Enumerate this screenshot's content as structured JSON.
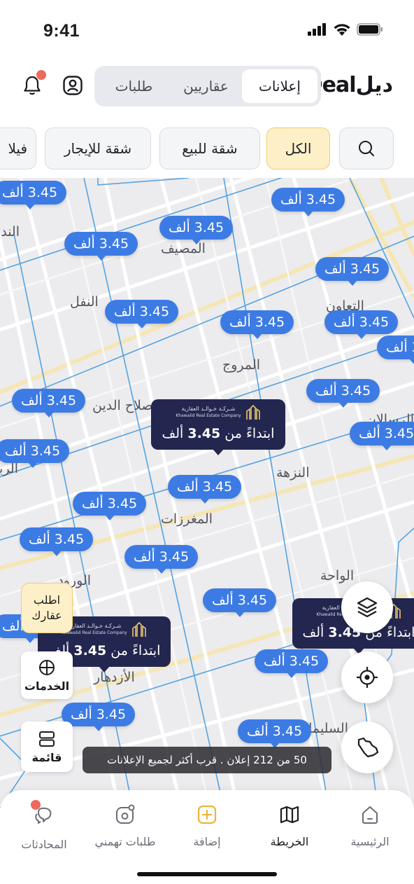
{
  "status_bar": {
    "time": "9:41"
  },
  "header": {
    "logo": "Dealديل",
    "tabs": [
      {
        "label": "إعلانات",
        "active": true
      },
      {
        "label": "عقاريين",
        "active": false
      },
      {
        "label": "طلبات",
        "active": false
      }
    ],
    "icons": [
      "profile-icon",
      "bell-icon"
    ]
  },
  "filters": {
    "search_icon": "search-icon",
    "chips": [
      {
        "label": "الكل",
        "active": true
      },
      {
        "label": "شقة للبيع",
        "active": false
      },
      {
        "label": "شقة للإيجار",
        "active": false
      },
      {
        "label": "فيلا",
        "active": false
      }
    ]
  },
  "map": {
    "districts": [
      "المصيف",
      "النفل",
      "المروج",
      "صلاح الدين",
      "النزهة",
      "المغرزات",
      "الواحة",
      "الأزدهار",
      "السليمانية",
      "التعاون",
      "الورود",
      "الندى",
      "الربيع",
      "الرسالات"
    ],
    "pin_label": "3.45 ألف",
    "company": {
      "name_ar": "شـركـة خـوالـد العقارية",
      "name_en": "Khawalid Real Estate Company",
      "price_prefix": "ابتداءً من",
      "price_value": "3.45",
      "price_unit": "ألف"
    }
  },
  "side_buttons": {
    "request_line1": "اطلب",
    "request_line2": "عقارك",
    "services": "الخدمات",
    "list": "قائمة"
  },
  "toast": "50 من 212 إعلان . قرب أكثر لجميع الإعلانات",
  "tabbar": [
    {
      "label": "الرئيسية",
      "icon": "home-icon",
      "active": false
    },
    {
      "label": "الخريطة",
      "icon": "map-icon",
      "active": true
    },
    {
      "label": "إضافة",
      "icon": "add-icon",
      "active": false
    },
    {
      "label": "طلبات تهمني",
      "icon": "requests-icon",
      "active": false
    },
    {
      "label": "المحادثات",
      "icon": "chat-icon",
      "active": false
    }
  ],
  "colors": {
    "pin": "#3d7be4",
    "company_card": "#23264f",
    "chip_active": "#fdf0c9",
    "notification": "#ee6a5c"
  }
}
